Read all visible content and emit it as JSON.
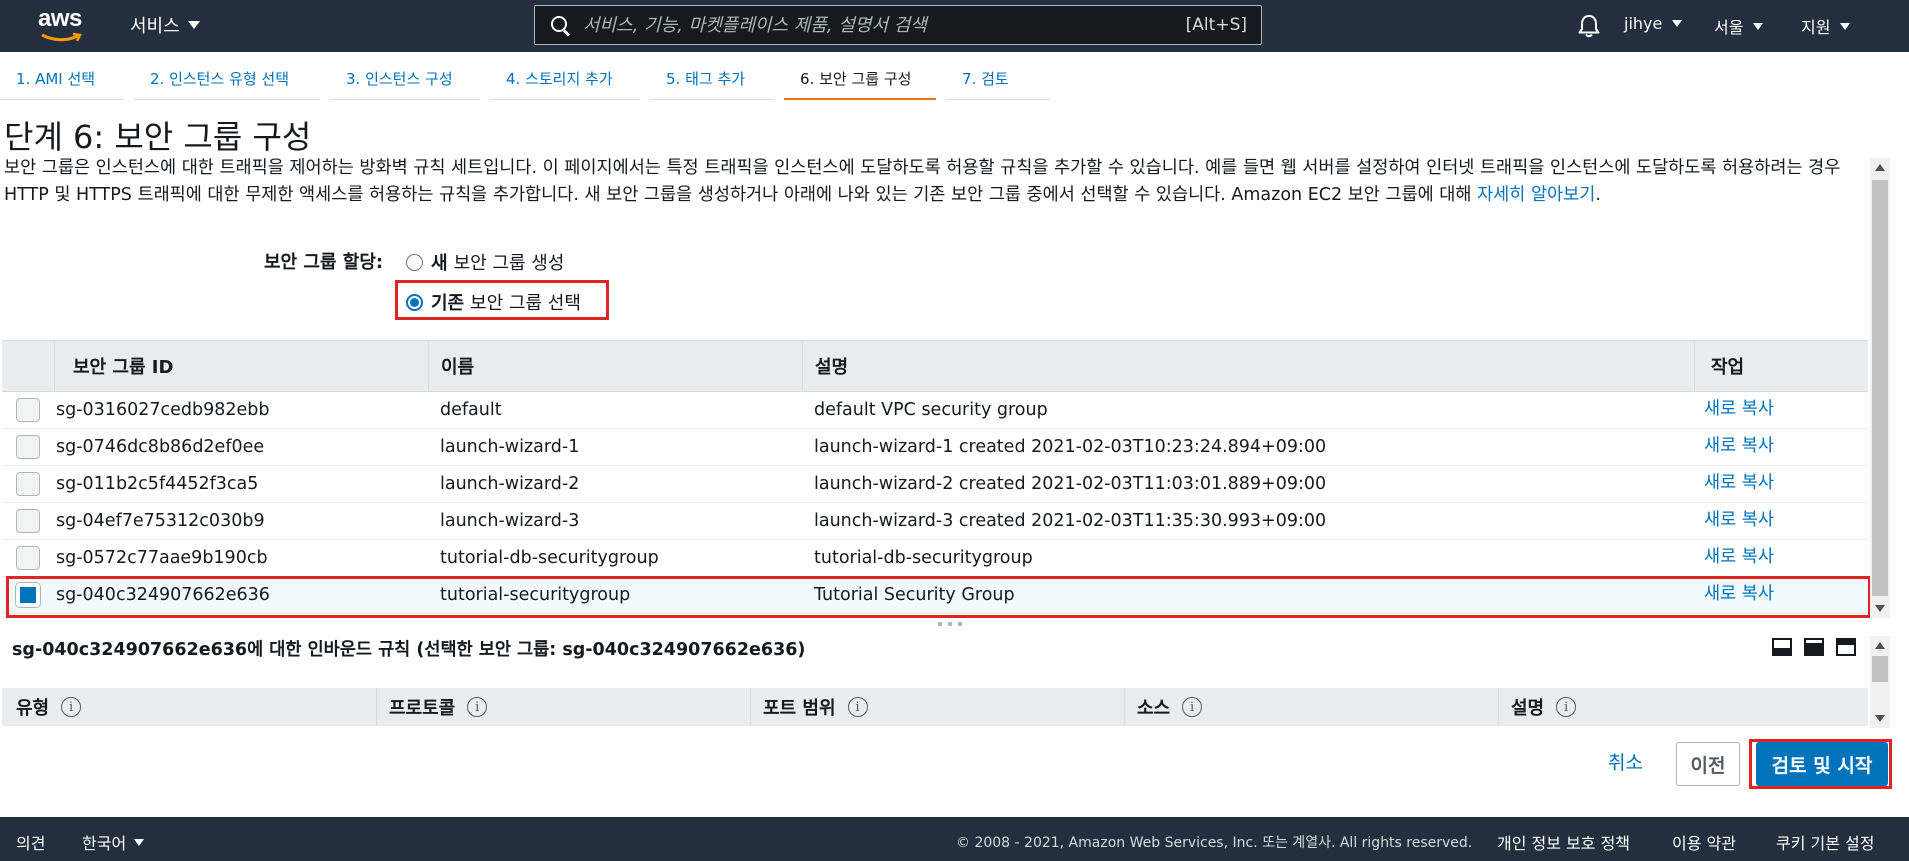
{
  "topnav": {
    "logo_text": "aws",
    "services_label": "서비스",
    "search_placeholder": "서비스, 기능, 마켓플레이스 제품, 설명서 검색",
    "search_shortcut": "[Alt+S]",
    "user": "jihye",
    "region": "서울",
    "support": "지원"
  },
  "tabs": [
    {
      "label": "1. AMI 선택"
    },
    {
      "label": "2. 인스턴스 유형 선택"
    },
    {
      "label": "3. 인스턴스 구성"
    },
    {
      "label": "4. 스토리지 추가"
    },
    {
      "label": "5. 태그 추가"
    },
    {
      "label": "6. 보안 그룹 구성"
    },
    {
      "label": "7. 검토"
    }
  ],
  "page": {
    "title": "단계 6: 보안 그룹 구성",
    "description": "보안 그룹은 인스턴스에 대한 트래픽을 제어하는 방화벽 규칙 세트입니다. 이 페이지에서는 특정 트래픽을 인스턴스에 도달하도록 허용할 규칙을 추가할 수 있습니다. 예를 들면 웹 서버를 설정하여 인터넷 트래픽을 인스턴스에 도달하도록 허용하려는 경우 HTTP 및 HTTPS 트래픽에 대한 무제한 액세스를 허용하는 규칙을 추가합니다. 새 보안 그룹을 생성하거나 아래에 나와 있는 기존 보안 그룹 중에서 선택할 수 있습니다. Amazon EC2 보안 그룹에 대해",
    "learn_more": "자세히 알아보기",
    "period": "."
  },
  "assign": {
    "label": "보안 그룹 할당:",
    "option_new_bold": "새",
    "option_new_rest": "보안 그룹 생성",
    "option_existing_bold": "기존",
    "option_existing_rest": "보안 그룹 선택",
    "selected": "existing"
  },
  "table": {
    "headers": [
      "보안 그룹 ID",
      "이름",
      "설명",
      "작업"
    ],
    "action_label": "새로 복사",
    "rows": [
      {
        "id": "sg-0316027cedb982ebb",
        "name": "default",
        "desc": "default VPC security group",
        "selected": false
      },
      {
        "id": "sg-0746dc8b86d2ef0ee",
        "name": "launch-wizard-1",
        "desc": "launch-wizard-1 created 2021-02-03T10:23:24.894+09:00",
        "selected": false
      },
      {
        "id": "sg-011b2c5f4452f3ca5",
        "name": "launch-wizard-2",
        "desc": "launch-wizard-2 created 2021-02-03T11:03:01.889+09:00",
        "selected": false
      },
      {
        "id": "sg-04ef7e75312c030b9",
        "name": "launch-wizard-3",
        "desc": "launch-wizard-3 created 2021-02-03T11:35:30.993+09:00",
        "selected": false
      },
      {
        "id": "sg-0572c77aae9b190cb",
        "name": "tutorial-db-securitygroup",
        "desc": "tutorial-db-securitygroup",
        "selected": false
      },
      {
        "id": "sg-040c324907662e636",
        "name": "tutorial-securitygroup",
        "desc": "Tutorial Security Group",
        "selected": true
      }
    ]
  },
  "inbound": {
    "title": "sg-040c324907662e636에 대한 인바운드 규칙 (선택한 보안 그룹: sg-040c324907662e636)",
    "headers": [
      "유형",
      "프로토콜",
      "포트 범위",
      "소스",
      "설명"
    ],
    "info_glyph": "i"
  },
  "actions": {
    "cancel": "취소",
    "previous": "이전",
    "review_launch": "검토 및 시작"
  },
  "footer": {
    "feedback": "의견",
    "language": "한국어",
    "copyright": "© 2008 - 2021, Amazon Web Services, Inc. 또는 계열사. All rights reserved.",
    "privacy": "개인 정보 보호 정책",
    "terms": "이용 약관",
    "cookies": "쿠키 기본 설정"
  },
  "colors": {
    "nav_bg": "#232f3e",
    "link": "#0073bb",
    "active_tab": "#ec7211",
    "highlight": "#e02424",
    "primary_button": "#0073bb"
  }
}
